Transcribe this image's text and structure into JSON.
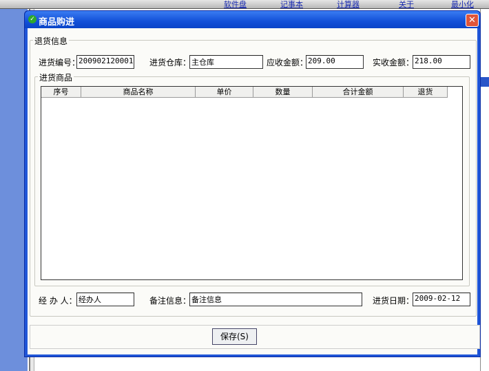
{
  "topbar": {
    "links": [
      "软件盘",
      "记事本",
      "计算器",
      "关于",
      "最小化"
    ]
  },
  "dialog": {
    "title": "商品购进",
    "close_icon": "close-icon",
    "return_info": {
      "legend": "退货信息",
      "purchase_no_label": "进货编号：",
      "purchase_no": "200902120001",
      "warehouse_label": "进货仓库：",
      "warehouse": "主仓库",
      "receivable_label": "应收金额：",
      "receivable": "209.00",
      "received_label": "实收金额：",
      "received": "218.00"
    },
    "goods": {
      "legend": "进货商品",
      "columns": [
        "序号",
        "商品名称",
        "单价",
        "数量",
        "合计金额",
        "退货"
      ],
      "rows": []
    },
    "handler_label": "经 办 人：",
    "handler": "经办人",
    "note_label": "备注信息：",
    "note": "备注信息",
    "date_label": "进货日期：",
    "date": "2009-02-12",
    "save_label": "保存(S)"
  }
}
